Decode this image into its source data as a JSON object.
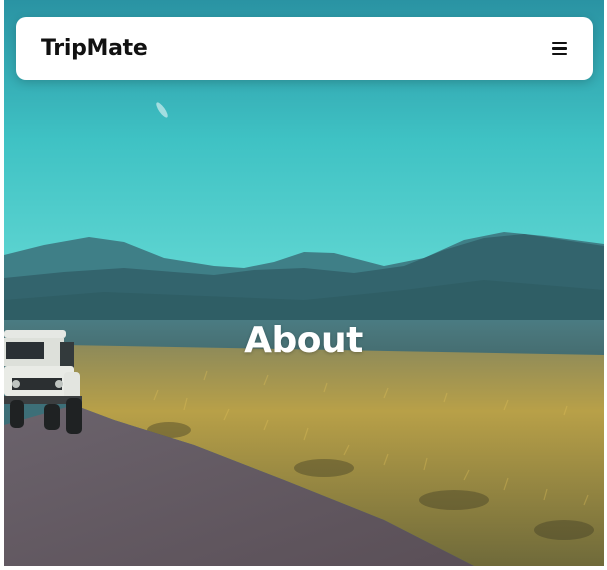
{
  "navbar": {
    "brand": "TripMate",
    "menu_icon": "hamburger-menu-icon"
  },
  "hero": {
    "title": "About"
  },
  "colors": {
    "sky": "#4ed1cf",
    "mountains": "#2f6f78",
    "grass": "#b59a3c",
    "road": "#6a6069",
    "title_text": "#ffffff"
  }
}
